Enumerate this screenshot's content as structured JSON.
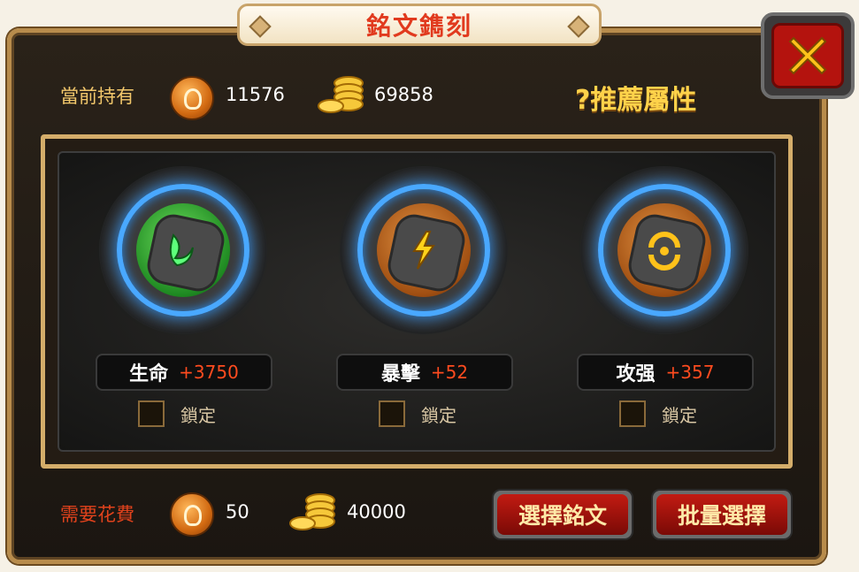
{
  "title": "銘文鐫刻",
  "holdings": {
    "label": "當前持有",
    "runes": "11576",
    "gold": "69858"
  },
  "recommend_label": "?推薦屬性",
  "slots": [
    {
      "stat": "生命",
      "value": "+3750",
      "lock_label": "鎖定",
      "core_color": "#1f8a22",
      "icon": "leaf-rune-icon"
    },
    {
      "stat": "暴擊",
      "value": "+52",
      "lock_label": "鎖定",
      "core_color": "#a04f12",
      "icon": "lightning-rune-icon"
    },
    {
      "stat": "攻强",
      "value": "+357",
      "lock_label": "鎖定",
      "core_color": "#a04f12",
      "icon": "circle-rune-icon"
    }
  ],
  "cost": {
    "label": "需要花費",
    "runes": "50",
    "gold": "40000"
  },
  "buttons": {
    "select": "選擇銘文",
    "batch": "批量選擇"
  }
}
